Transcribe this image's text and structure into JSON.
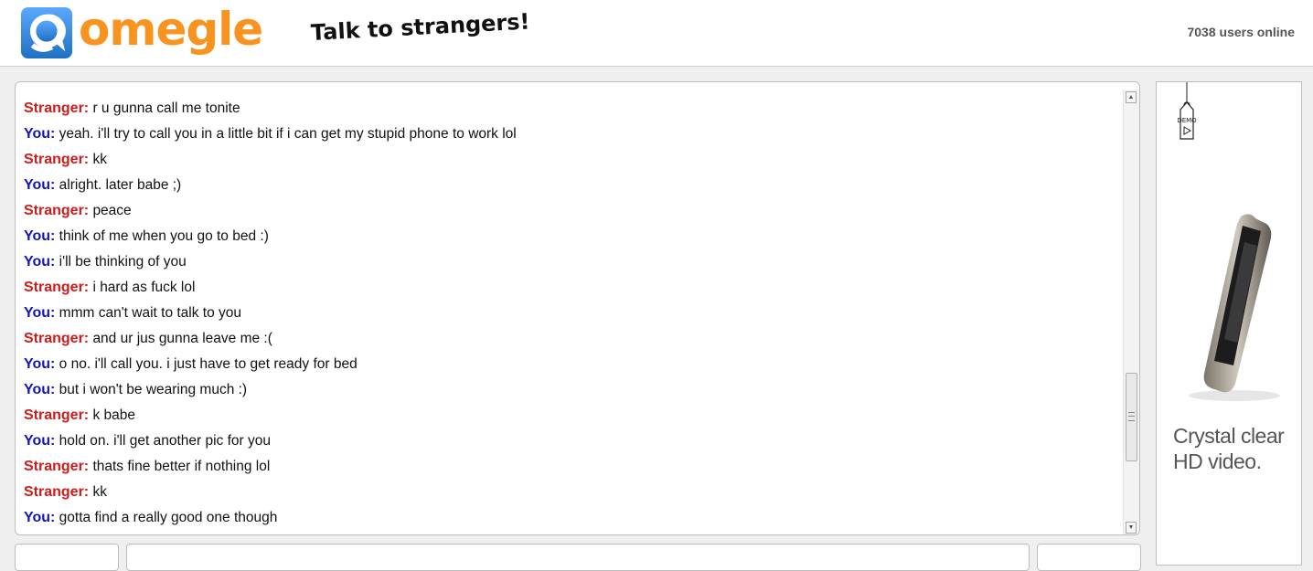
{
  "header": {
    "logo_text": "omegle",
    "tagline": "Talk to strangers!",
    "users_online": "7038 users online"
  },
  "colors": {
    "brand_orange": "#f7931e",
    "brand_blue": "#3d8de0",
    "stranger": "#d11a1a",
    "you": "#1515b4"
  },
  "chat": {
    "messages": [
      {
        "who": "Stranger:",
        "text": "r u gunna call me tonite"
      },
      {
        "who": "You:",
        "text": "yeah. i'll try to call you in a little bit if i can get my stupid phone to work lol"
      },
      {
        "who": "Stranger:",
        "text": "kk"
      },
      {
        "who": "You:",
        "text": "alright. later babe ;)"
      },
      {
        "who": "Stranger:",
        "text": "peace"
      },
      {
        "who": "You:",
        "text": "think of me when you go to bed :)"
      },
      {
        "who": "You:",
        "text": "i'll be thinking of you"
      },
      {
        "who": "Stranger:",
        "text": "i hard as fuck lol"
      },
      {
        "who": "You:",
        "text": "mmm can't wait to talk to you"
      },
      {
        "who": "Stranger:",
        "text": "and ur jus gunna leave me :("
      },
      {
        "who": "You:",
        "text": "o no. i'll call you. i just have to get ready for bed"
      },
      {
        "who": "You:",
        "text": "but i won't be wearing much :)"
      },
      {
        "who": "Stranger:",
        "text": "k babe"
      },
      {
        "who": "You:",
        "text": "hold on. i'll get another pic for you"
      },
      {
        "who": "Stranger:",
        "text": "thats fine better if nothing lol"
      },
      {
        "who": "Stranger:",
        "text": "kk"
      },
      {
        "who": "You:",
        "text": "gotta find a really good one though"
      }
    ]
  },
  "ad": {
    "tag_text": "DEMO",
    "headline": "Crystal clear HD video."
  },
  "icons": {
    "logo": "omegle-speech-bubble-icon",
    "scroll_up": "triangle-up",
    "scroll_down": "triangle-down"
  }
}
